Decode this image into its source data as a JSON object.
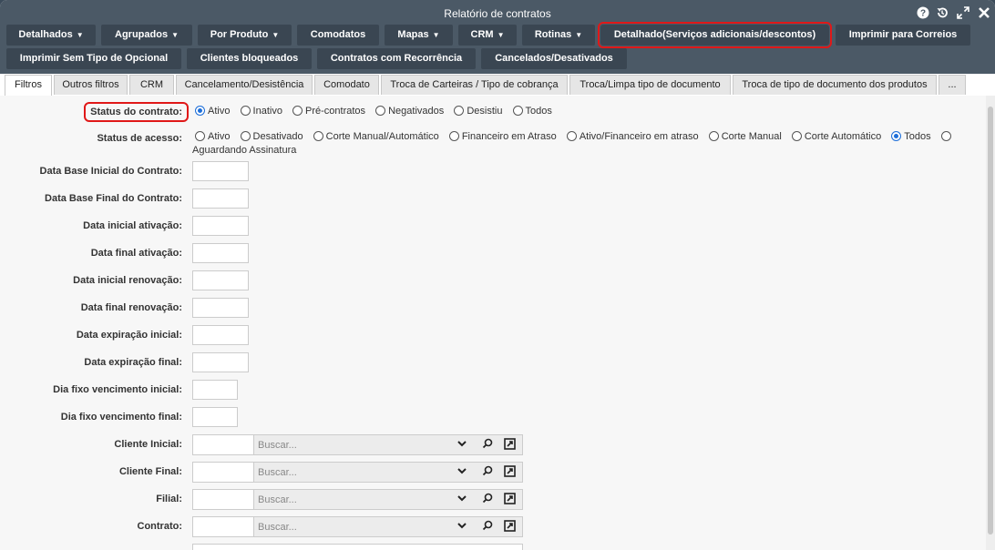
{
  "window": {
    "title": "Relatório de contratos"
  },
  "toolbar": {
    "row1": [
      {
        "label": "Detalhados",
        "dropdown": true
      },
      {
        "label": "Agrupados",
        "dropdown": true
      },
      {
        "label": "Por Produto",
        "dropdown": true
      },
      {
        "label": "Comodatos",
        "dropdown": false
      },
      {
        "label": "Mapas",
        "dropdown": true
      },
      {
        "label": "CRM",
        "dropdown": true
      },
      {
        "label": "Rotinas",
        "dropdown": true
      },
      {
        "label": "Detalhado(Serviços adicionais/descontos)",
        "dropdown": false,
        "highlighted": true
      },
      {
        "label": "Imprimir para Correios",
        "dropdown": false
      }
    ],
    "row2": [
      {
        "label": "Imprimir Sem Tipo de Opcional"
      },
      {
        "label": "Clientes bloqueados"
      },
      {
        "label": "Contratos com Recorrência"
      },
      {
        "label": "Cancelados/Desativados"
      }
    ]
  },
  "tabs": [
    {
      "label": "Filtros",
      "active": true
    },
    {
      "label": "Outros filtros"
    },
    {
      "label": "CRM"
    },
    {
      "label": "Cancelamento/Desistência"
    },
    {
      "label": "Comodato"
    },
    {
      "label": "Troca de Carteiras / Tipo de cobrança"
    },
    {
      "label": "Troca/Limpa tipo de documento"
    },
    {
      "label": "Troca de tipo de documento dos produtos"
    },
    {
      "label": "..."
    }
  ],
  "filters": {
    "status_contrato": {
      "label": "Status do contrato:",
      "options": [
        "Ativo",
        "Inativo",
        "Pré-contratos",
        "Negativados",
        "Desistiu",
        "Todos"
      ],
      "selected": "Ativo"
    },
    "status_acesso": {
      "label": "Status de acesso:",
      "options": [
        "Ativo",
        "Desativado",
        "Corte Manual/Automático",
        "Financeiro em Atraso",
        "Ativo/Financeiro em atraso",
        "Corte Manual",
        "Corte Automático",
        "Todos",
        "Aguardando Assinatura"
      ],
      "selected": "Todos"
    },
    "date_fields": [
      {
        "label": "Data Base Inicial do Contrato:",
        "value": ""
      },
      {
        "label": "Data Base Final do Contrato:",
        "value": ""
      },
      {
        "label": "Data inicial ativação:",
        "value": ""
      },
      {
        "label": "Data final ativação:",
        "value": ""
      },
      {
        "label": "Data inicial renovação:",
        "value": ""
      },
      {
        "label": "Data final renovação:",
        "value": ""
      },
      {
        "label": "Data expiração inicial:",
        "value": ""
      },
      {
        "label": "Data expiração final:",
        "value": ""
      }
    ],
    "day_fields": [
      {
        "label": "Dia fixo vencimento inicial:",
        "value": ""
      },
      {
        "label": "Dia fixo vencimento final:",
        "value": ""
      }
    ],
    "lookup_fields": [
      {
        "label": "Cliente Inicial:",
        "placeholder": "Buscar..."
      },
      {
        "label": "Cliente Final:",
        "placeholder": "Buscar..."
      },
      {
        "label": "Filial:",
        "placeholder": "Buscar..."
      },
      {
        "label": "Contrato:",
        "placeholder": "Buscar..."
      }
    ]
  },
  "icons": {
    "help": "help-icon",
    "history": "history-icon",
    "maximize": "maximize-icon",
    "close": "close-icon"
  }
}
